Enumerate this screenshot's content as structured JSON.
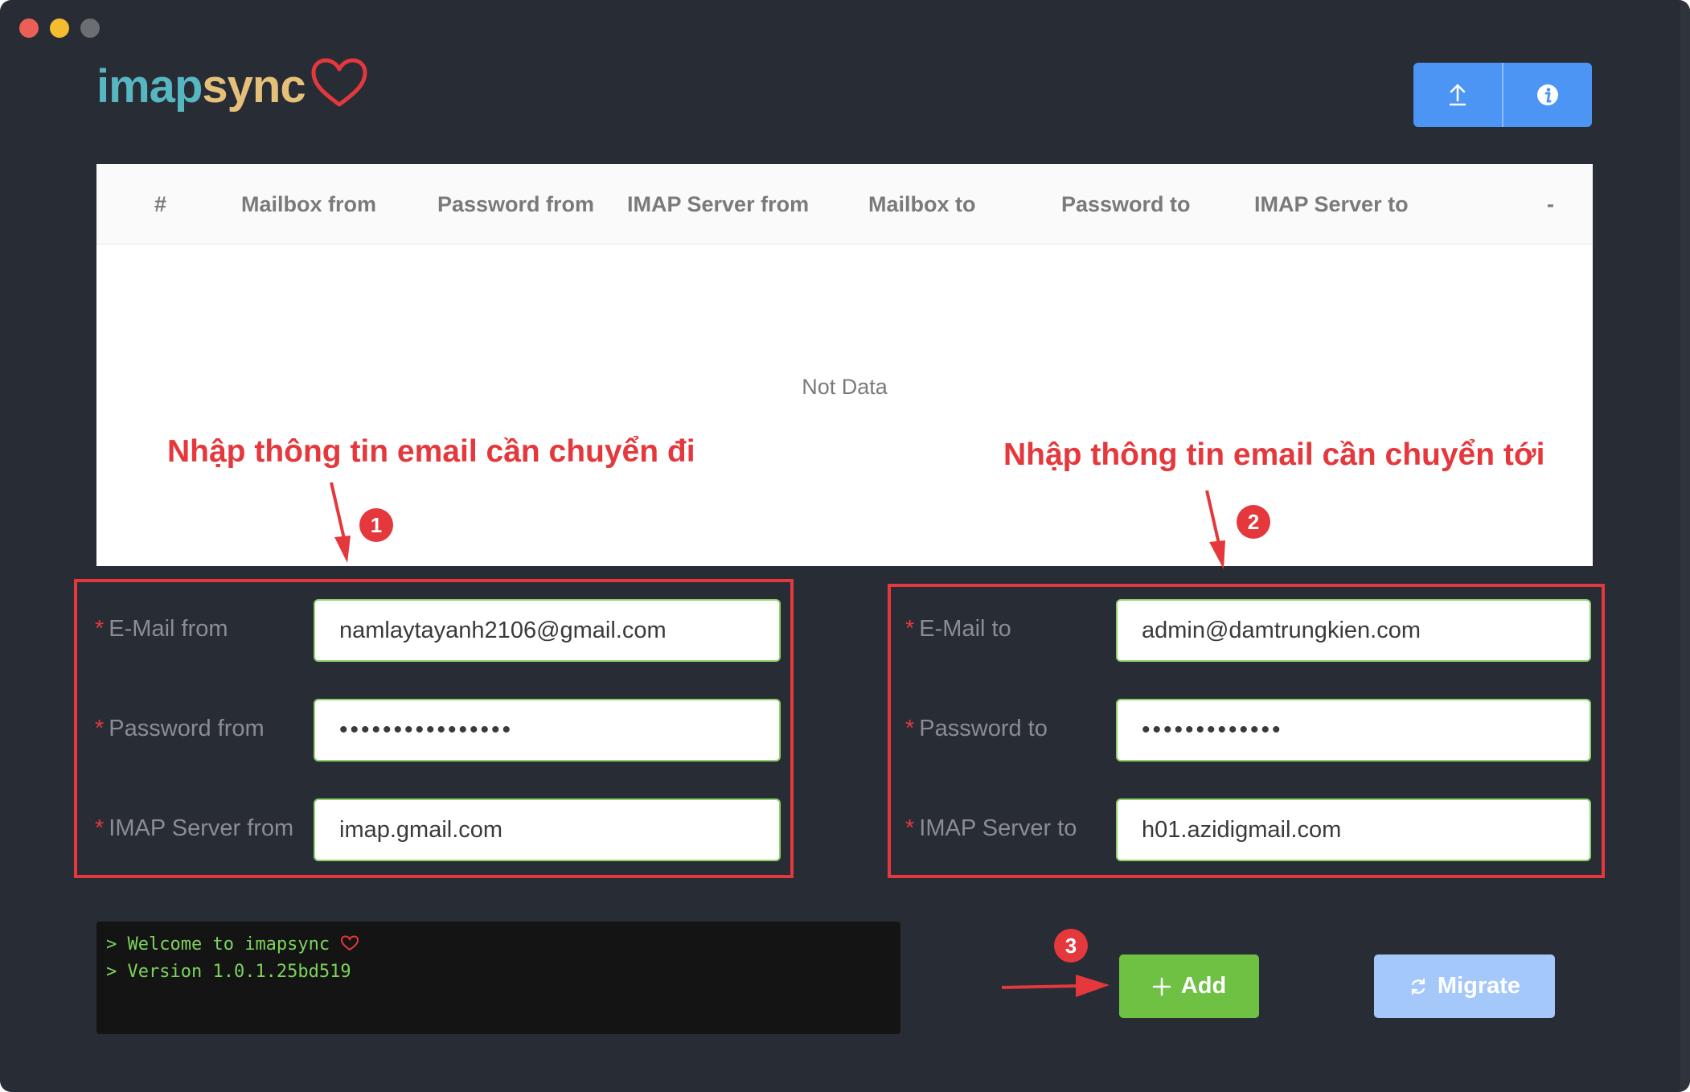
{
  "window": {
    "title": ""
  },
  "logo": {
    "part1": "imap",
    "part2": "sync"
  },
  "toolbar": {
    "upload_icon": "upload-icon",
    "info_icon": "info-icon"
  },
  "table": {
    "headers": [
      "#",
      "Mailbox from",
      "Password from",
      "IMAP Server from",
      "Mailbox to",
      "Password to",
      "IMAP Server to",
      "-"
    ],
    "empty_text": "Not Data"
  },
  "annotations": {
    "left_title": "Nhập thông tin email cần chuyển đi",
    "right_title": "Nhập thông tin email cần chuyển tới",
    "badge1": "1",
    "badge2": "2",
    "badge3": "3",
    "color": "#e4383d"
  },
  "form_from": {
    "email_label": "E-Mail from",
    "email_value": "namlaytayanh2106@gmail.com",
    "password_label": "Password from",
    "password_value": "••••••••••••••••",
    "server_label": "IMAP Server from",
    "server_value": "imap.gmail.com"
  },
  "form_to": {
    "email_label": "E-Mail to",
    "email_value": "admin@damtrungkien.com",
    "password_label": "Password to",
    "password_value": "•••••••••••••",
    "server_label": "IMAP Server to",
    "server_value": "h01.azidigmail.com"
  },
  "required_mark": "*",
  "console": {
    "prompt": ">",
    "line1": "Welcome to imapsync",
    "line2": "Version 1.0.1.25bd519"
  },
  "buttons": {
    "add_label": "Add",
    "migrate_label": "Migrate"
  },
  "colors": {
    "background": "#282c34",
    "primary": "#4c95f5",
    "success": "#6ec143",
    "migrate_disabled": "#a5c8fa",
    "console_text": "#7dd35c"
  }
}
